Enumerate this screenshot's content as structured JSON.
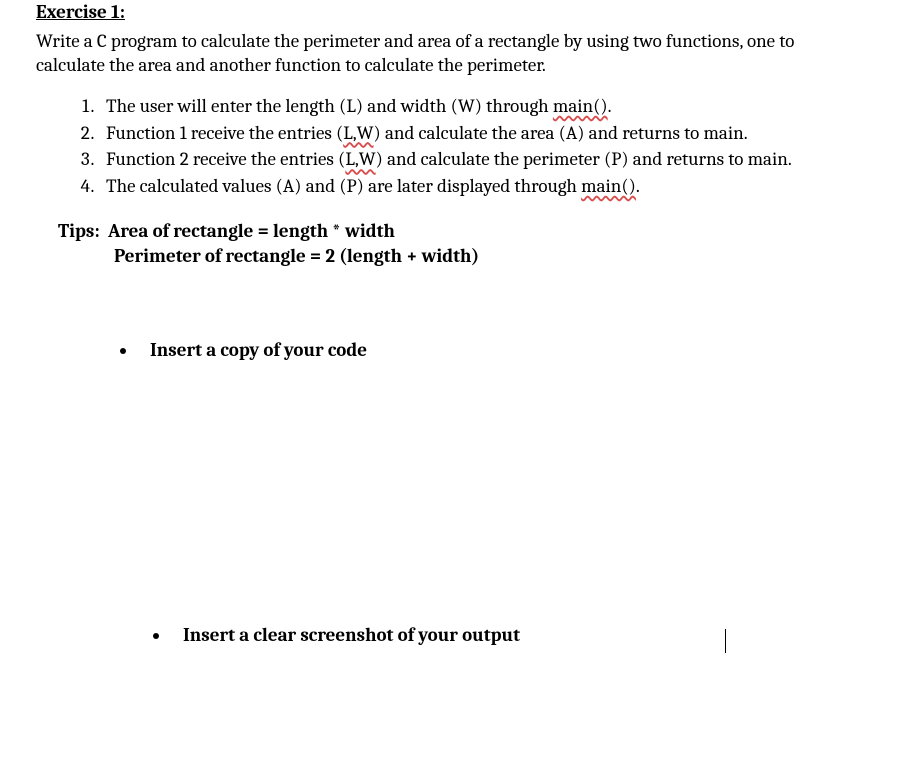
{
  "title": "Exercise 1:",
  "intro": "Write a C program to calculate the perimeter and area of a rectangle by using two functions, one to calculate the area and another function to calculate the perimeter.",
  "steps": [
    {
      "prefix": "The user will enter the length (L) and width (W) through ",
      "u1": "main()",
      "suffix": "."
    },
    {
      "prefix": "Function 1 receive the entries (",
      "u1": "L,W",
      "mid": ") and calculate the area (A) and returns to main.",
      "u2": "",
      "suffix": ""
    },
    {
      "prefix": "Function 2 receive the entries (",
      "u1": "L,W",
      "mid": ") and calculate the perimeter (P) and returns to main.",
      "u2": "",
      "suffix": ""
    },
    {
      "prefix": "The calculated values (A) and (P) are later displayed through ",
      "u1": "main()",
      "suffix": "."
    }
  ],
  "tips": {
    "label": "Tips:",
    "line1": "Area of rectangle = length * width",
    "line2": "Perimeter of rectangle = 2 (length + width)"
  },
  "bullets": {
    "code": "Insert a copy of your code",
    "output": "Insert a clear screenshot of your output"
  }
}
